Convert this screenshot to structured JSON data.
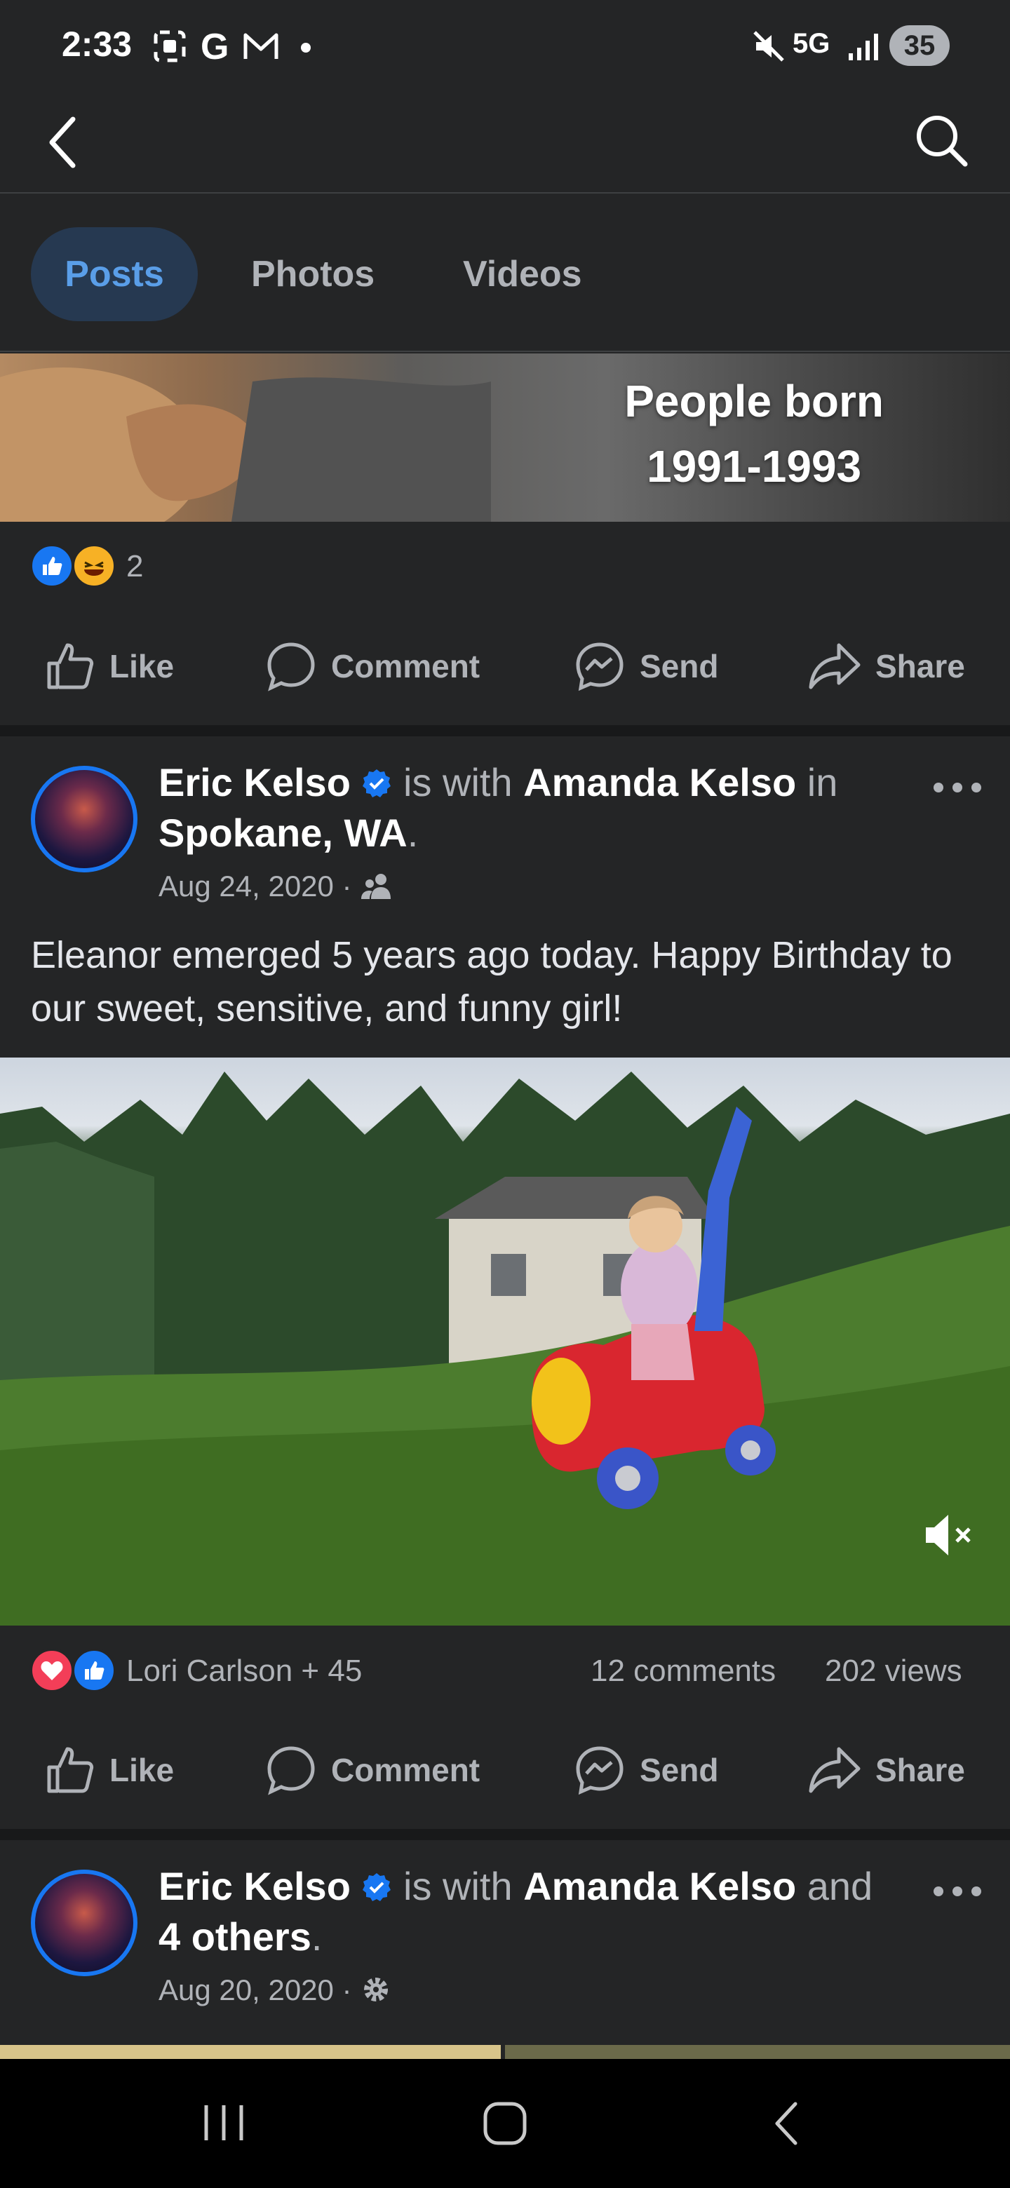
{
  "status_bar": {
    "time": "2:33",
    "network": "5G",
    "battery": "35"
  },
  "tabs": [
    {
      "label": "Posts",
      "active": true
    },
    {
      "label": "Photos",
      "active": false
    },
    {
      "label": "Videos",
      "active": false
    }
  ],
  "post1": {
    "banner_line1": "People born",
    "banner_line2": "1991-1993",
    "reaction_count": "2"
  },
  "actions": {
    "like": "Like",
    "comment": "Comment",
    "send": "Send",
    "share": "Share"
  },
  "post2": {
    "author": "Eric Kelso",
    "with_text": "is with",
    "tagged": "Amanda Kelso",
    "in_text": "in",
    "location": "Spokane, WA",
    "period": ".",
    "date": "Aug 24, 2020 ·",
    "text": "Eleanor emerged 5 years ago today. Happy Birthday to our sweet, sensitive, and funny girl!",
    "reactors": "Lori Carlson + 45",
    "comments": "12 comments",
    "views": "202 views"
  },
  "post3": {
    "author": "Eric Kelso",
    "with_text": "is with",
    "tagged": "Amanda Kelso",
    "and_text": "and",
    "others": "4 others",
    "period": ".",
    "date": "Aug 20, 2020 ·"
  },
  "colors": {
    "background": "#242526",
    "accent": "#1877f2",
    "active_tab_bg": "#263951",
    "active_tab_text": "#5a9ee8",
    "text_secondary": "#b0b3b8"
  }
}
